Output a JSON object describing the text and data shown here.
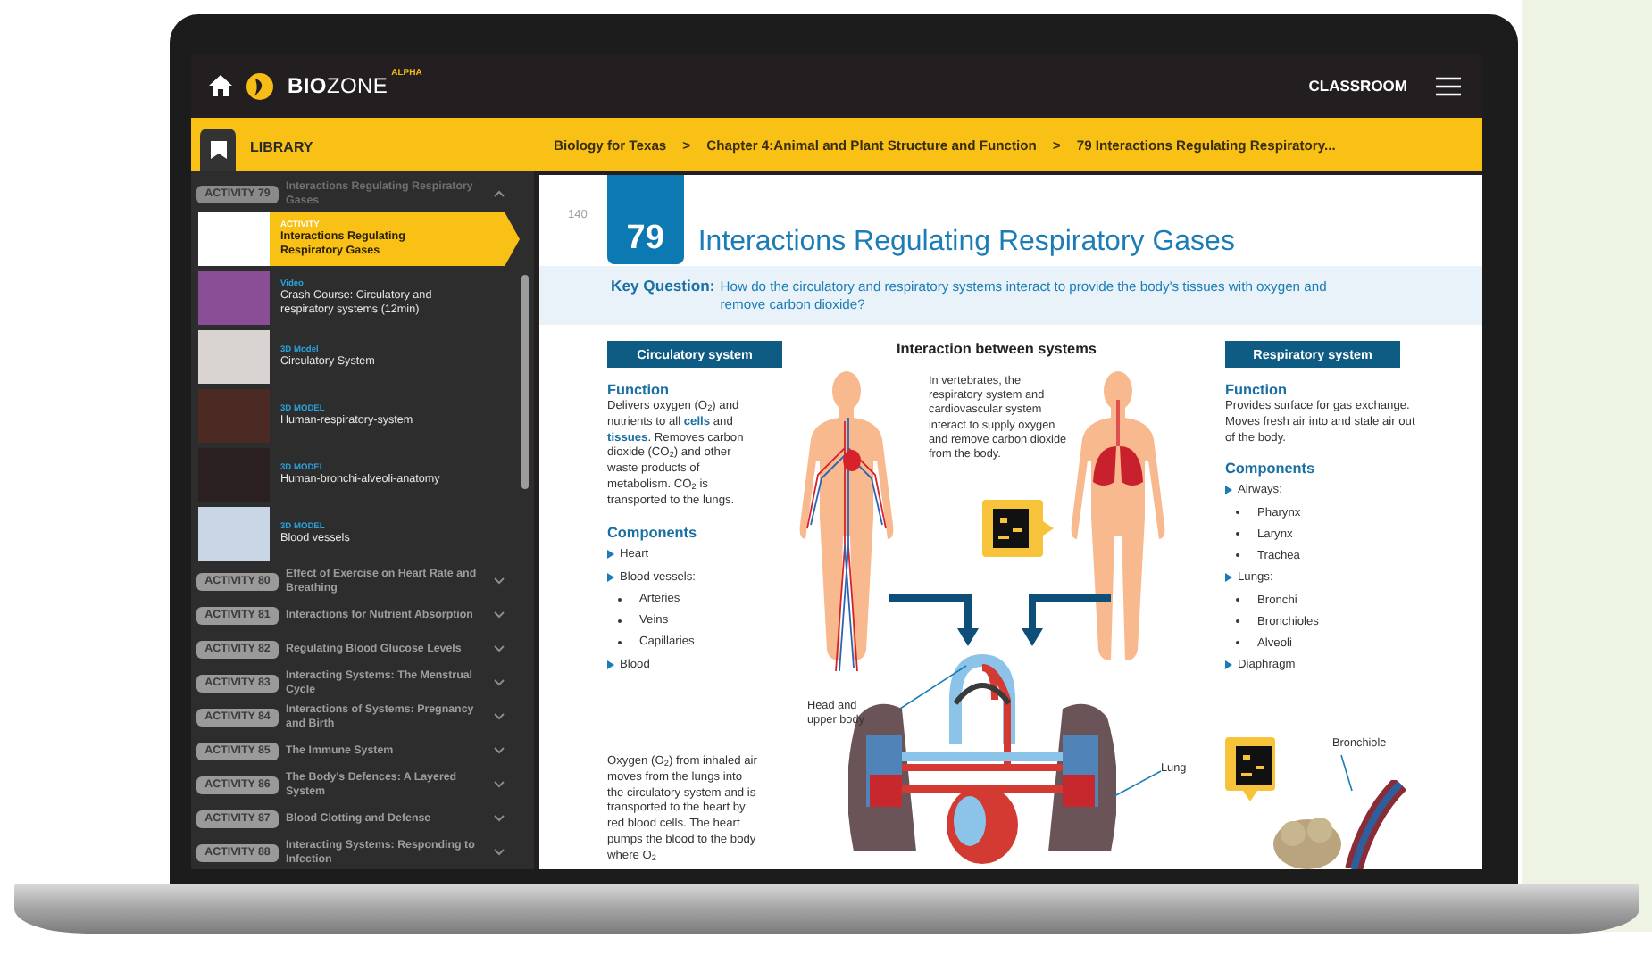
{
  "topbar": {
    "logo": "**BIO**ZONE",
    "logo_badge": "ALPHA",
    "classroom": "CLASSROOM"
  },
  "library_bar": {
    "label": "LIBRARY",
    "breadcrumbs": [
      {
        "kind": "crumb",
        "text": "Biology for Texas"
      },
      {
        "kind": "separator",
        "text": ">"
      },
      {
        "kind": "crumb",
        "text": "Chapter 4:Animal and Plant Structure and Function"
      },
      {
        "kind": "separator",
        "text": ">"
      },
      {
        "kind": "crumb",
        "text": "79 Interactions Regulating Respiratory..."
      }
    ]
  },
  "sidebar": {
    "activities": [
      {
        "badge": "ACTIVITY 79",
        "title": "Interactions Regulating Respiratory Gases",
        "expanded": true,
        "resources": [
          {
            "type": "ACTIVITY",
            "title": "Interactions Regulating Respiratory Gases",
            "selected": true
          },
          {
            "type": "Video",
            "title": "Crash Course: Circulatory and respiratory systems (12min)",
            "selected": false
          },
          {
            "type": "3D Model",
            "title": "Circulatory System",
            "selected": false
          },
          {
            "type": "3D MODEL",
            "title": "Human-respiratory-system",
            "selected": false
          },
          {
            "type": "3D MODEL",
            "title": "Human-bronchi-alveoli-anatomy",
            "selected": false
          },
          {
            "type": "3D MODEL",
            "title": "Blood vessels",
            "selected": false
          }
        ]
      },
      {
        "badge": "ACTIVITY 80",
        "title": "Effect of Exercise on Heart Rate and Breathing",
        "expanded": false
      },
      {
        "badge": "ACTIVITY 81",
        "title": "Interactions for Nutrient Absorption",
        "expanded": false
      },
      {
        "badge": "ACTIVITY 82",
        "title": "Regulating Blood Glucose Levels",
        "expanded": false
      },
      {
        "badge": "ACTIVITY 83",
        "title": "Interacting Systems: The Menstrual Cycle",
        "expanded": false
      },
      {
        "badge": "ACTIVITY 84",
        "title": "Interactions of Systems: Pregnancy and Birth",
        "expanded": false
      },
      {
        "badge": "ACTIVITY 85",
        "title": "The Immune System",
        "expanded": false
      },
      {
        "badge": "ACTIVITY 86",
        "title": "The Body's Defences: A Layered System",
        "expanded": false
      },
      {
        "badge": "ACTIVITY 87",
        "title": "Blood Clotting and Defense",
        "expanded": false
      },
      {
        "badge": "ACTIVITY 88",
        "title": "Interacting Systems: Responding to Infection",
        "expanded": false
      }
    ]
  },
  "document": {
    "page_number": "140",
    "activity_number": "79",
    "title": "Interactions Regulating Respiratory Gases",
    "key_question": {
      "label": "Key Question:",
      "text": "How do the circulatory and respiratory systems interact to provide the body's tissues with oxygen and remove carbon dioxide?"
    },
    "circulatory": {
      "heading": "Circulatory system",
      "function_heading": "Function",
      "function_text": "Delivers oxygen (O$_{2}$) and nutrients to all **cells** and **tissues**. Removes carbon dioxide (CO$_{2}$) and other waste products of metabolism. CO$_{2}$ is transported to the lungs.",
      "components_heading": "Components",
      "components": [
        {
          "text": "Heart"
        },
        {
          "text": "Blood vessels:",
          "children": [
            {
              "text": "Arteries"
            },
            {
              "text": "Veins"
            },
            {
              "text": "Capillaries"
            }
          ]
        },
        {
          "text": "Blood"
        }
      ],
      "bottom_text": "Oxygen (O$_{2}$) from inhaled air moves from the lungs into the circulatory system and is transported to the heart by red blood cells. The heart pumps the blood to the body where O$_{2}$"
    },
    "interaction": {
      "heading": "Interaction between systems",
      "intro": "In vertebrates, the respiratory system and cardiovascular system interact to supply oxygen and remove carbon dioxide from the body.",
      "labels": [
        "Head and upper body",
        "Lung"
      ]
    },
    "respiratory": {
      "heading": "Respiratory system",
      "function_heading": "Function",
      "function_text": "Provides surface for gas exchange. Moves fresh air into and stale air out of the body.",
      "components_heading": "Components",
      "components": [
        {
          "text": "Airways:",
          "children": [
            {
              "text": "Pharynx"
            },
            {
              "text": "Larynx"
            },
            {
              "text": "Trachea"
            }
          ]
        },
        {
          "text": "Lungs:",
          "children": [
            {
              "text": "Bronchi"
            },
            {
              "text": "Bronchioles"
            },
            {
              "text": "Alveoli"
            }
          ]
        },
        {
          "text": "Diaphragm"
        }
      ],
      "label": "Bronchiole"
    }
  }
}
